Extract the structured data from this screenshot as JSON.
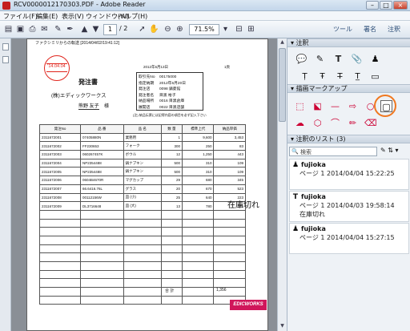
{
  "window": {
    "title": "RCV0000012170303.PDF - Adobe Reader",
    "minimize": "–",
    "maximize": "□",
    "close": "×"
  },
  "menu": [
    "ファイル(F)",
    "編集(E)",
    "表示(V)",
    "ウィンドウ(W)",
    "ヘルプ(H)"
  ],
  "toolbar": {
    "page_current": "1",
    "page_total": "/ 2",
    "zoom": "71.5%",
    "links": [
      "ツール",
      "署名",
      "注釈"
    ]
  },
  "document": {
    "fax_header": "ファクシミリからの転送 [2014/04/02/19:41:12]",
    "date_stamp": "'14.04.04",
    "date_line": "2012年6月13日",
    "page_label": "1頁",
    "heading": "発注書",
    "recipient": "(株)エディックワークス",
    "person": "熊野 友子",
    "honorific": "様",
    "info": [
      [
        "取引先No",
        "00175000"
      ],
      [
        "指定納期",
        "2012年6月20日"
      ],
      [
        "発注店",
        "0098 鎮菱館"
      ],
      [
        "発注者名",
        "目黒 裕子"
      ],
      [
        "納品場所",
        "0016 目黒倉庫"
      ],
      [
        "展開店",
        "0022 目黒店舗"
      ]
    ],
    "note": "(注) 納品伝票には記得内容の項目を必ず記入下さい",
    "table": {
      "headers": [
        "発注No",
        "品 番",
        "品 名",
        "数 量",
        "標準上代",
        "納品単価"
      ],
      "rows": [
        [
          "2311672001",
          "07405880N",
          "業務用",
          "1",
          "9,600",
          "3,453"
        ],
        [
          "2311672002",
          "FF230653",
          "フォーク",
          "300",
          "250",
          "83"
        ],
        [
          "2311672003",
          "060267457K",
          "ボウル",
          "12",
          "1,250",
          "443"
        ],
        [
          "2311672004",
          "NP2354488",
          "鍋ナプキン",
          "500",
          "310",
          "109"
        ],
        [
          "2311672005",
          "NP2354488",
          "鍋ナプキン",
          "500",
          "310",
          "109"
        ],
        [
          "2311672006",
          "0604B4670R",
          "マグカップ",
          "29",
          "680",
          "345"
        ],
        [
          "2311672007",
          "66.6416.76L",
          "グラス",
          "20",
          "670",
          "523"
        ],
        [
          "2311672008",
          "00112156W",
          "皿 (小)",
          "25",
          "640",
          "223"
        ],
        [
          "2311672009",
          "DL3716648",
          "皿 (大)",
          "13",
          "780",
          "275"
        ]
      ],
      "empty_rows": 11,
      "total_label": "合 計",
      "total_value": "1,356"
    },
    "annotation": "在庫切れ",
    "logo": "EDICWORKS"
  },
  "panel": {
    "annotations_title": "注釈",
    "drawing_title": "描画マークアップ",
    "list_title": "注釈のリスト (3)",
    "search_placeholder": "検索",
    "comments": [
      {
        "author": "fujioka",
        "date": "ページ 1 2014/04/04 15:22:25",
        "text": ""
      },
      {
        "author": "fujioka",
        "date": "ページ 1 2014/04/03 19:58:14",
        "text": "在庫切れ"
      },
      {
        "author": "fujioka",
        "date": "ページ 1 2014/04/04 15:27:15",
        "text": ""
      }
    ]
  },
  "colors": {
    "stamp": "#e0241c",
    "highlight_circle": "#f07820",
    "logo_bg": "#d0165a",
    "panel_bg": "#eef2f6"
  }
}
